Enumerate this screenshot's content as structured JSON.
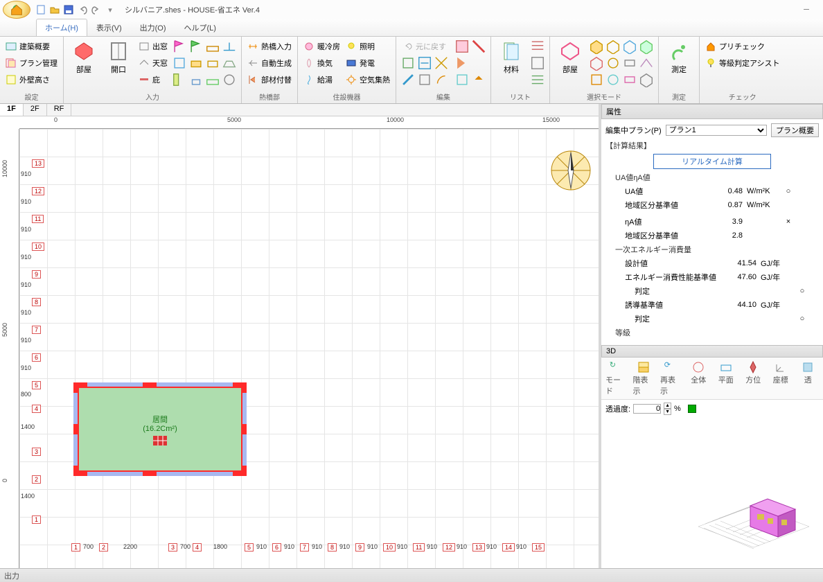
{
  "title": "シルバニア.shes - HOUSE-省エネ Ver.4",
  "tabs": {
    "home": "ホーム(H)",
    "view": "表示(V)",
    "output": "出力(O)",
    "help": "ヘルプ(L)"
  },
  "ribbon": {
    "settings": {
      "label": "設定",
      "b1": "建築概要",
      "b2": "プラン管理",
      "b3": "外壁高さ"
    },
    "input": {
      "label": "入力",
      "room": "部屋",
      "opening": "開口",
      "bay": "出窓",
      "sky": "天窓",
      "eave": "庇"
    },
    "bridge": {
      "label": "熱橋部",
      "b1": "熱橋入力",
      "b2": "自動生成",
      "b3": "部材付替"
    },
    "equip": {
      "label": "住設機器",
      "hvac": "暖冷房",
      "vent": "換気",
      "hw": "給湯",
      "light": "照明",
      "pv": "発電",
      "solar": "空気集熱"
    },
    "edit": {
      "label": "編集",
      "undo": "元に戻す"
    },
    "list": {
      "label": "リスト",
      "mat": "材料"
    },
    "selmode": {
      "label": "選択モード",
      "room": "部屋"
    },
    "measure": {
      "label": "測定",
      "btn": "測定"
    },
    "check": {
      "label": "チェック",
      "pre": "プリチェック",
      "grade": "等級判定アシスト"
    }
  },
  "floors": {
    "f1": "1F",
    "f2": "2F",
    "rf": "RF"
  },
  "ruler_h": [
    "0",
    "5000",
    "10000",
    "15000"
  ],
  "ruler_v": [
    "0",
    "5000",
    "10000"
  ],
  "grid_v": [
    "13",
    "12",
    "11",
    "10",
    "9",
    "8",
    "7",
    "6",
    "5",
    "4",
    "3",
    "2",
    "1"
  ],
  "grid_v_dims": [
    "910",
    "910",
    "910",
    "910",
    "910",
    "910",
    "910",
    "910",
    "800",
    "1400",
    "1400"
  ],
  "grid_h": [
    "1",
    "2",
    "3",
    "4",
    "5",
    "6",
    "7",
    "8",
    "9",
    "10",
    "11",
    "12",
    "13",
    "14",
    "15"
  ],
  "grid_h_dims": [
    "700",
    "2200",
    "700",
    "1800",
    "910",
    "910",
    "910",
    "910",
    "910",
    "910",
    "910",
    "910",
    "910",
    "910"
  ],
  "room": {
    "name": "居間",
    "area": "(16.2Cm²)"
  },
  "attr": {
    "title": "属性",
    "editing_plan_label": "編集中プラン(P)",
    "plan_selected": "プラン1",
    "plan_overview": "プラン概要",
    "calc_results": "【計算結果】",
    "realtime": "リアルタイム計算",
    "ua_group": "UA値ηA値",
    "ua_label": "UA値",
    "ua_val": "0.48",
    "ua_unit": "W/m²K",
    "ua_mark": "○",
    "region_label": "地域区分基準値",
    "region_val": "0.87",
    "region_unit": "W/m²K",
    "eta_label": "ηA値",
    "eta_val": "3.9",
    "eta_mark": "×",
    "eta_region_val": "2.8",
    "energy_group": "一次エネルギー消費量",
    "design_label": "設計値",
    "design_val": "41.54",
    "gj": "GJ/年",
    "perf_std_label": "エネルギー消費性能基準値",
    "perf_std_val": "47.60",
    "judge_label": "判定",
    "judge_mark": "○",
    "induce_label": "誘導基準値",
    "induce_val": "44.10",
    "grade_label": "等級"
  },
  "d3": {
    "title": "3D",
    "mode": "モード",
    "floor": "階表示",
    "redisp": "再表示",
    "all": "全体",
    "plan": "平面",
    "dir": "方位",
    "coord": "座標",
    "trans": "透",
    "opacity_label": "透過度:",
    "opacity_val": "0",
    "pct": "%"
  },
  "output_label": "出力"
}
